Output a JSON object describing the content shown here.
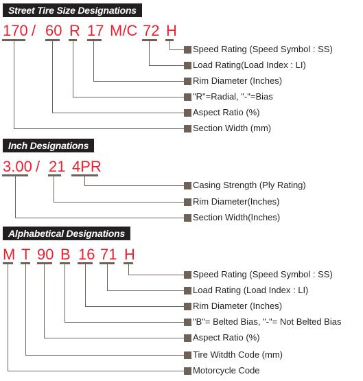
{
  "sections": [
    {
      "title": "Street Tire Size Designations",
      "codes": [
        "170",
        "60",
        "R",
        "17",
        "M/C",
        "72",
        "H"
      ],
      "separator": "/",
      "labels": [
        "Speed Rating (Speed Symbol : SS)",
        "Load Rating(Load Index : LI)",
        "Rim Diameter (Inches)",
        "\"R\"=Radial, \"-\"=Bias",
        "Aspect Ratio (%)",
        "Section Width (mm)"
      ]
    },
    {
      "title": "Inch Designations",
      "codes": [
        "3.00",
        "21",
        "4PR"
      ],
      "separator": "/",
      "labels": [
        "Casing Strength (Ply Rating)",
        "Rim Diameter(Inches)",
        "Section Width(Inches)"
      ]
    },
    {
      "title": "Alphabetical Designations",
      "codes": [
        "M",
        "T",
        "90",
        "B",
        "16",
        "71",
        "H"
      ],
      "labels": [
        "Speed Rating (Speed Symbol : SS)",
        "Load Rating (Load Index : LI)",
        "Rim Diameter (Inches)",
        "\"B\"= Belted Bias, \"-\"= Not Belted Bias",
        "Aspect Ratio (%)",
        "Tire Witdth Code (mm)",
        "Motorcycle Code"
      ]
    }
  ],
  "colors": {
    "code_text": "#e8232f",
    "connector": "#6e6157",
    "header_bg": "#231f20",
    "header_text": "#ffffff",
    "label_text": "#231f20"
  }
}
